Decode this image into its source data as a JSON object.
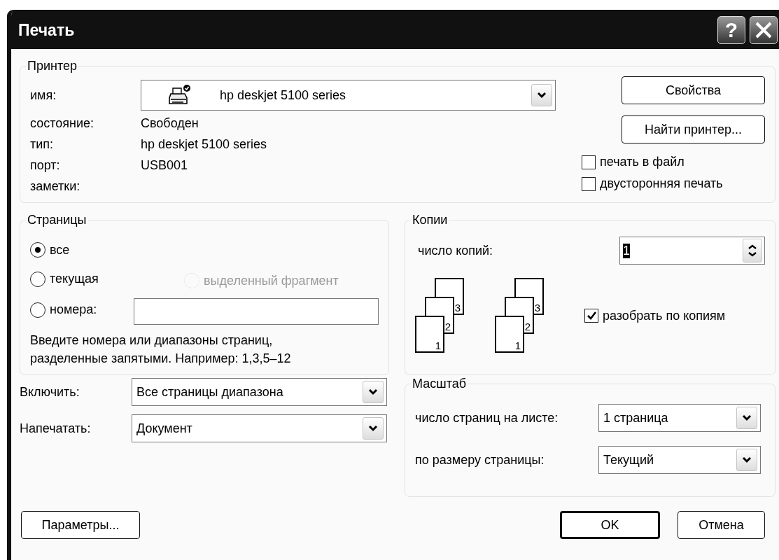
{
  "window": {
    "title": "Печать",
    "buttons": [
      {
        "kind": "help",
        "label": "?"
      },
      {
        "kind": "close"
      }
    ]
  },
  "printer": {
    "legend": "Принтер",
    "name_label": "имя:",
    "name": "hp deskjet 5100 series",
    "fields": [
      {
        "label": "состояние:",
        "value": "Свободен"
      },
      {
        "label": "тип:",
        "value": "hp deskjet 5100 series"
      },
      {
        "label": "порт:",
        "value": "USB001"
      },
      {
        "label": "заметки:"
      }
    ],
    "buttons": [
      "Свойства",
      "Найти принтер..."
    ],
    "checkboxes": [
      {
        "label": "печать в файл",
        "checked": false
      },
      {
        "label": "двусторонняя печать",
        "checked": false
      }
    ]
  },
  "pages": {
    "legend": "Страницы",
    "options": [
      {
        "label": "все",
        "selected": true
      },
      {
        "label": "текущая",
        "selected": false
      },
      {
        "label": "номера:",
        "selected": false
      }
    ],
    "selection_option": {
      "label": "выделенный фрагмент",
      "selected": false,
      "disabled": true
    },
    "hint": "Введите номера или диапазоны страниц,\nразделенные запятыми. Например: 1,3,5–12"
  },
  "copies": {
    "legend": "Копии",
    "count_label": "число копий:",
    "count": "1",
    "illustrations": [
      {
        "pages": [
          "1",
          "2",
          "3"
        ]
      },
      {
        "pages": [
          "1",
          "2",
          "3"
        ]
      }
    ],
    "collate": {
      "label": "разобрать по копиям",
      "checked": true
    }
  },
  "include": {
    "label": "Включить:",
    "value": "Все страницы диапазона"
  },
  "print_what": {
    "label": "Напечатать:",
    "value": "Документ"
  },
  "zoom": {
    "legend": "Масштаб",
    "rows": [
      {
        "label": "число страниц на листе:",
        "value": "1 страница"
      },
      {
        "label": "по размеру страницы:",
        "value": "Текущий"
      }
    ]
  },
  "buttons": {
    "options": "Параметры...",
    "ok": "OK",
    "cancel": "Отмена"
  }
}
